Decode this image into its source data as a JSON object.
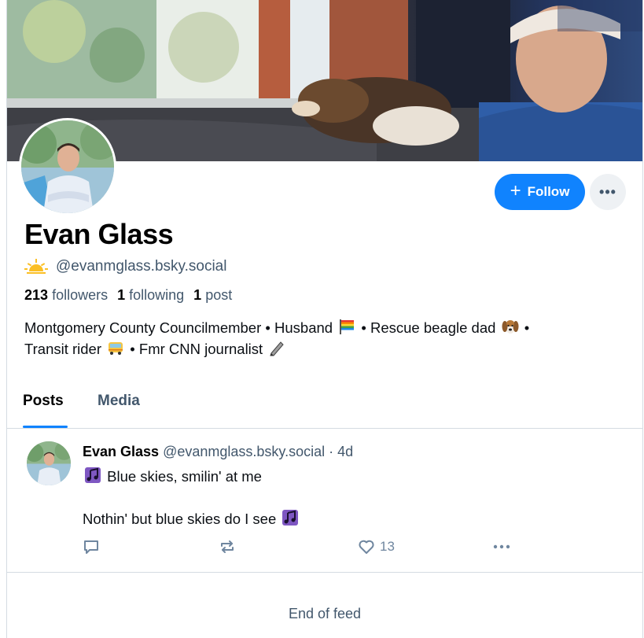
{
  "profile": {
    "display_name": "Evan Glass",
    "handle": "@evanmglass.bsky.social",
    "followers_count": "213",
    "followers_label": "followers",
    "following_count": "1",
    "following_label": "following",
    "posts_count": "1",
    "posts_label": "post",
    "bio_line1_a": "Montgomery County Councilmember • Husband",
    "bio_line1_b": "• Rescue beagle dad",
    "bio_line1_c": "•",
    "bio_line2_a": "Transit rider",
    "bio_line2_b": "• Fmr CNN journalist"
  },
  "actions": {
    "follow_label": "Follow",
    "more_label": "•••"
  },
  "tabs": [
    {
      "label": "Posts",
      "active": true
    },
    {
      "label": "Media",
      "active": false
    }
  ],
  "post": {
    "author": "Evan Glass",
    "handle": "@evanmglass.bsky.social",
    "separator": "·",
    "time": "4d",
    "line1": "Blue skies, smilin' at me",
    "line2": "Nothin' but blue skies do I see",
    "like_count": "13"
  },
  "feed": {
    "end_label": "End of feed"
  },
  "colors": {
    "accent": "#1083fe",
    "muted_text": "#42576c",
    "icon_gray": "#6f869f",
    "divider": "#d4dbe2"
  },
  "icons": [
    "sun-icon",
    "rainbow-flag-icon",
    "dog-face-icon",
    "bus-icon",
    "pencil-icon",
    "music-notes-icon",
    "reply-icon",
    "repost-icon",
    "heart-icon",
    "more-icon",
    "plus-icon"
  ]
}
